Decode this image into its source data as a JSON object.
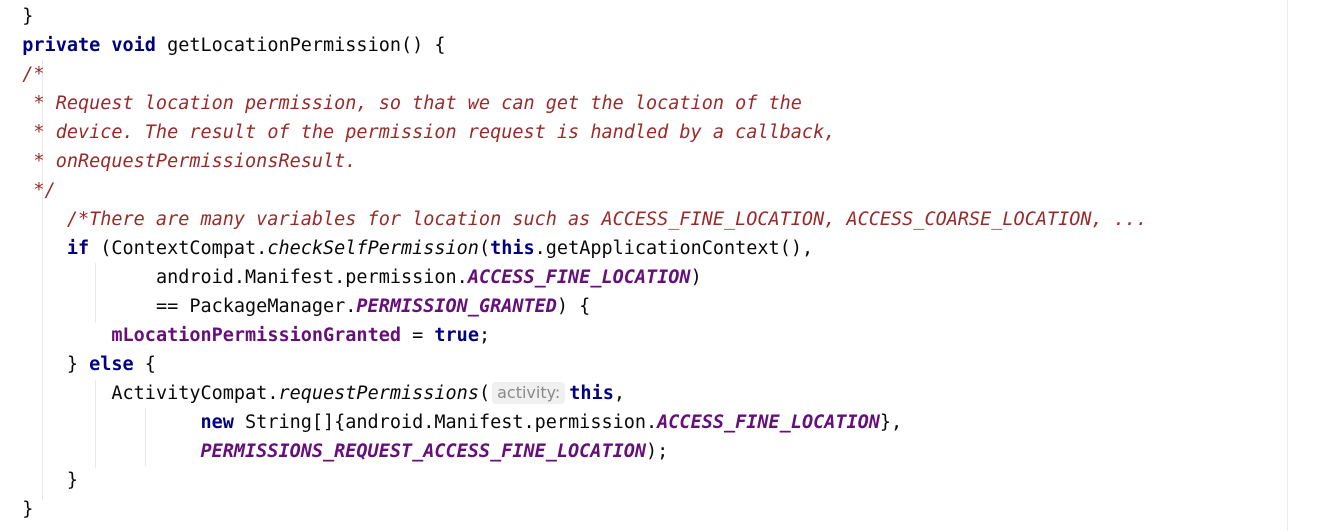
{
  "code_lines": [
    {
      "indent": "  ",
      "parts": [
        {
          "t": "p",
          "v": "}"
        }
      ]
    },
    {
      "indent": "  ",
      "parts": [
        {
          "t": "kw",
          "v": "private"
        },
        {
          "t": "p",
          "v": " "
        },
        {
          "t": "kw",
          "v": "void"
        },
        {
          "t": "p",
          "v": " getLocationPermission() {"
        }
      ]
    },
    {
      "indent": "  ",
      "parts": [
        {
          "t": "cm",
          "v": "/*"
        }
      ]
    },
    {
      "indent": "  ",
      "parts": [
        {
          "t": "cm",
          "v": " * Request location permission, so that we can get the location of the"
        }
      ]
    },
    {
      "indent": "  ",
      "parts": [
        {
          "t": "cm",
          "v": " * device. The result of the permission request is handled by a callback,"
        }
      ]
    },
    {
      "indent": "  ",
      "parts": [
        {
          "t": "cm",
          "v": " * onRequestPermissionsResult."
        }
      ]
    },
    {
      "indent": "  ",
      "parts": [
        {
          "t": "cm",
          "v": " */"
        }
      ]
    },
    {
      "indent": "      ",
      "parts": [
        {
          "t": "cm",
          "v": "/*There are many variables for location such as ACCESS_FINE_LOCATION, ACCESS_COARSE_LOCATION, ..."
        }
      ]
    },
    {
      "indent": "      ",
      "parts": [
        {
          "t": "kw",
          "v": "if"
        },
        {
          "t": "p",
          "v": " (ContextCompat."
        },
        {
          "t": "me",
          "v": "checkSelfPermission"
        },
        {
          "t": "p",
          "v": "("
        },
        {
          "t": "kw",
          "v": "this"
        },
        {
          "t": "p",
          "v": ".getApplicationContext(),"
        }
      ]
    },
    {
      "indent": "              ",
      "parts": [
        {
          "t": "p",
          "v": "android.Manifest.permission."
        },
        {
          "t": "st",
          "v": "ACCESS_FINE_LOCATION"
        },
        {
          "t": "p",
          "v": ")"
        }
      ]
    },
    {
      "indent": "              ",
      "parts": [
        {
          "t": "p",
          "v": "== PackageManager."
        },
        {
          "t": "st",
          "v": "PERMISSION_GRANTED"
        },
        {
          "t": "p",
          "v": ") {"
        }
      ]
    },
    {
      "indent": "          ",
      "parts": [
        {
          "t": "fd",
          "v": "mLocationPermissionGranted"
        },
        {
          "t": "p",
          "v": " = "
        },
        {
          "t": "kw",
          "v": "true"
        },
        {
          "t": "p",
          "v": ";"
        }
      ]
    },
    {
      "indent": "      ",
      "parts": [
        {
          "t": "p",
          "v": "} "
        },
        {
          "t": "kw",
          "v": "else"
        },
        {
          "t": "p",
          "v": " {"
        }
      ]
    },
    {
      "indent": "          ",
      "parts": [
        {
          "t": "p",
          "v": "ActivityCompat."
        },
        {
          "t": "me",
          "v": "requestPermissions"
        },
        {
          "t": "p",
          "v": "("
        },
        {
          "t": "hint",
          "v": "activity:"
        },
        {
          "t": "kw",
          "v": "this"
        },
        {
          "t": "p",
          "v": ","
        }
      ]
    },
    {
      "indent": "                  ",
      "parts": [
        {
          "t": "kw",
          "v": "new"
        },
        {
          "t": "p",
          "v": " String[]{android.Manifest.permission."
        },
        {
          "t": "st",
          "v": "ACCESS_FINE_LOCATION"
        },
        {
          "t": "p",
          "v": "},"
        }
      ]
    },
    {
      "indent": "                  ",
      "parts": [
        {
          "t": "st",
          "v": "PERMISSIONS_REQUEST_ACCESS_FINE_LOCATION"
        },
        {
          "t": "p",
          "v": ");"
        }
      ]
    },
    {
      "indent": "      ",
      "parts": [
        {
          "t": "p",
          "v": "}"
        }
      ]
    },
    {
      "indent": "  ",
      "parts": [
        {
          "t": "p",
          "v": "}"
        }
      ]
    }
  ]
}
